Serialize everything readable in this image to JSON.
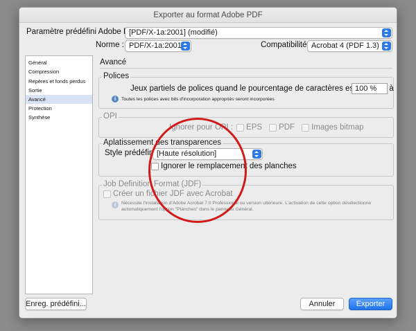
{
  "window": {
    "title": "Exporter au format Adobe PDF"
  },
  "preset": {
    "label": "Paramètre prédéfini Adobe PDF :",
    "value": "[PDF/X-1a:2001] (modifié)"
  },
  "standard": {
    "label": "Norme :",
    "value": "PDF/X-1a:2001"
  },
  "compat": {
    "label": "Compatibilité :",
    "value": "Acrobat 4 (PDF 1.3)"
  },
  "sidebar": {
    "items": [
      {
        "label": "Général"
      },
      {
        "label": "Compression"
      },
      {
        "label": "Repères et fonds perdus"
      },
      {
        "label": "Sortie"
      },
      {
        "label": "Avancé"
      },
      {
        "label": "Protection"
      },
      {
        "label": "Synthèse"
      }
    ]
  },
  "panel": {
    "title": "Avancé"
  },
  "fonts": {
    "title": "Polices",
    "subset_label": "Jeux partiels de polices quand le pourcentage de caractères est inférieur à :",
    "subset_value": "100 %",
    "info": "Toutes les polices avec bits d'incorporation appropriés seront incorporées"
  },
  "opi": {
    "title": "OPI",
    "ignore_label": "Ignorer pour OPI :",
    "eps": "EPS",
    "pdf": "PDF",
    "bitmap": "Images bitmap"
  },
  "flatten": {
    "title": "Aplatissement des transparences",
    "style_label": "Style prédéfini :",
    "style_value": "[Haute résolution]",
    "ignore_override": "Ignorer le remplacement des planches"
  },
  "jdf": {
    "title": "Job Definition Format (JDF)",
    "create": "Créer un fichier JDF avec Acrobat",
    "info_line1": "Nécessite l'installation d'Adobe Acrobat 7.0 Professional ou version ultérieure. L'activation de cette option désélectionne",
    "info_line2": "automatiquement l'option \"Planches\" dans le panneau Général."
  },
  "buttons": {
    "save_preset": "Enreg. prédéfini...",
    "cancel": "Annuler",
    "export": "Exporter"
  },
  "colors": {
    "accent": "#2d7ae6",
    "annotation": "#d11a1a",
    "selection": "#d7e3f5"
  }
}
